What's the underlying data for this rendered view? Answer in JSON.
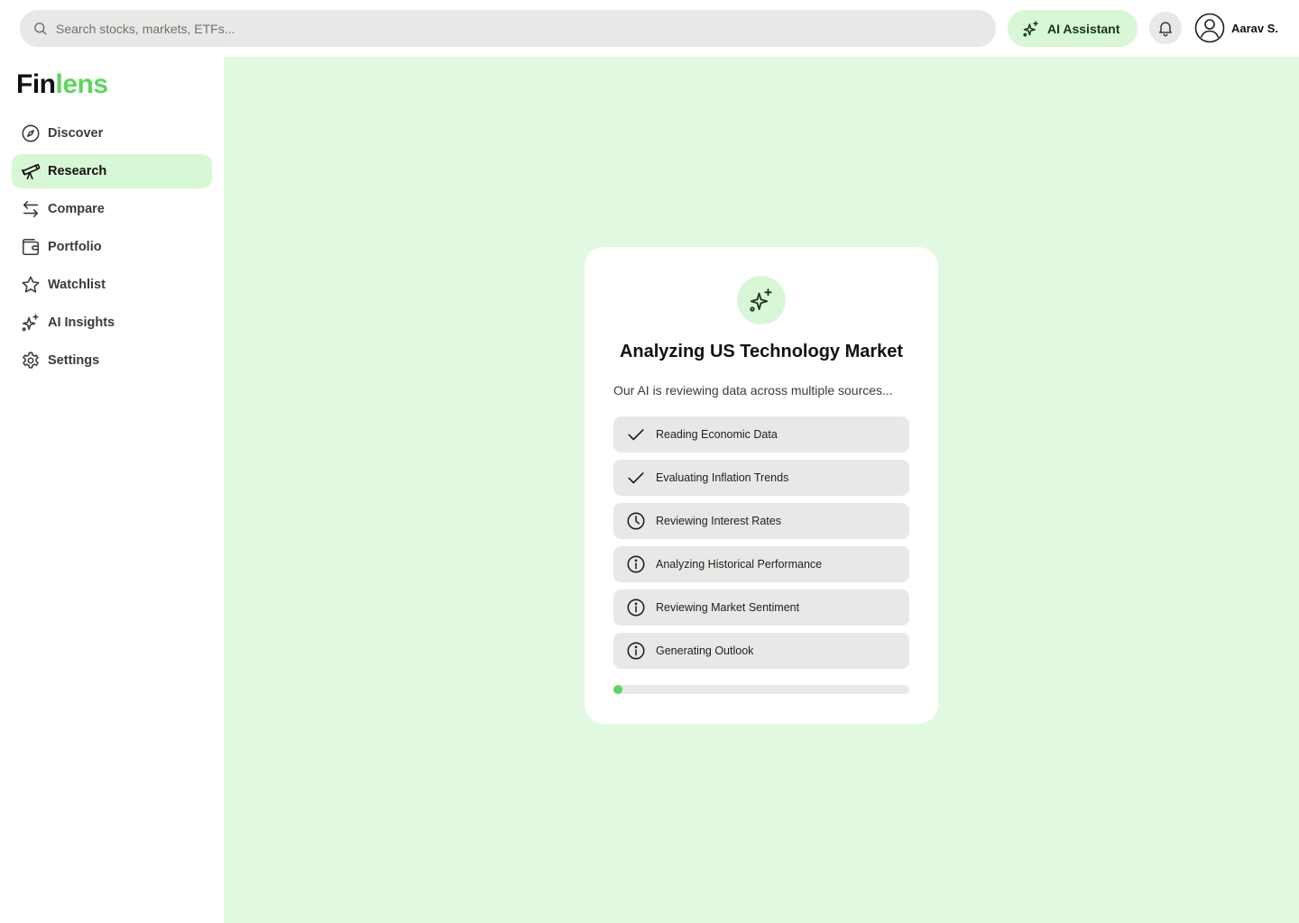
{
  "header": {
    "search_placeholder": "Search stocks, markets, ETFs...",
    "ai_button_label": "AI Assistant",
    "user_name": "Aarav S."
  },
  "brand": {
    "logo_part1": "Fin",
    "logo_part2": "lens",
    "accent_color": "#5fd45f"
  },
  "sidebar": {
    "items": [
      {
        "label": "Discover",
        "icon": "compass-icon",
        "active": false
      },
      {
        "label": "Research",
        "icon": "telescope-icon",
        "active": true
      },
      {
        "label": "Compare",
        "icon": "arrows-exchange-icon",
        "active": false
      },
      {
        "label": "Portfolio",
        "icon": "wallet-icon",
        "active": false
      },
      {
        "label": "Watchlist",
        "icon": "star-icon",
        "active": false
      },
      {
        "label": "AI Insights",
        "icon": "sparkles-icon",
        "active": false
      },
      {
        "label": "Settings",
        "icon": "gear-icon",
        "active": false
      }
    ]
  },
  "analysis": {
    "title": "Analyzing US Technology Market",
    "subtitle": "Our AI is reviewing data across multiple sources...",
    "steps": [
      {
        "label": "Reading Economic Data",
        "status": "done",
        "icon": "check-icon"
      },
      {
        "label": "Evaluating Inflation Trends",
        "status": "done",
        "icon": "check-icon"
      },
      {
        "label": "Reviewing Interest Rates",
        "status": "in-progress",
        "icon": "clock-icon"
      },
      {
        "label": "Analyzing Historical Performance",
        "status": "pending",
        "icon": "info-icon"
      },
      {
        "label": "Reviewing Market Sentiment",
        "status": "pending",
        "icon": "info-icon"
      },
      {
        "label": "Generating Outlook",
        "status": "pending",
        "icon": "info-icon"
      }
    ],
    "progress_fraction": 0.03
  }
}
